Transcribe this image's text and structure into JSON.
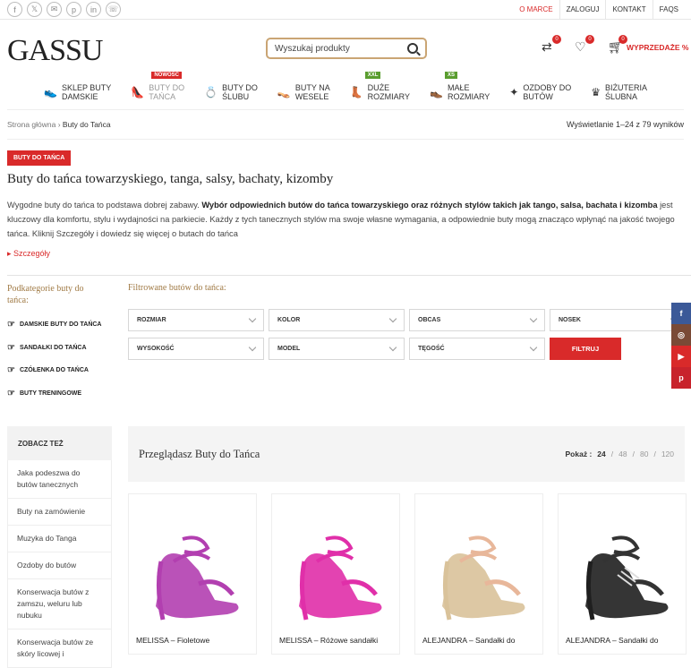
{
  "topbar": {
    "socials": [
      {
        "icon": "facebook-icon",
        "glyph": "f"
      },
      {
        "icon": "x-icon",
        "glyph": "𝕏"
      },
      {
        "icon": "email-icon",
        "glyph": "✉"
      },
      {
        "icon": "pinterest-icon",
        "glyph": "p"
      },
      {
        "icon": "linkedin-icon",
        "glyph": "in"
      },
      {
        "icon": "whatsapp-icon",
        "glyph": "☏"
      }
    ],
    "links": {
      "about": "O MARCE",
      "login": "ZALOGUJ",
      "contact": "KONTAKT",
      "faqs": "FAQS"
    }
  },
  "header": {
    "logo": "GASSU",
    "search_placeholder": "Wyszukaj produkty",
    "compare_count": "0",
    "wishlist_count": "0",
    "cart_count": "0",
    "sale_label": "WYPRZEDAŻE %"
  },
  "nav": [
    {
      "line1": "SKLEP BUTY",
      "line2": "DAMSKIE",
      "icon": "shoes-icon",
      "glyph": "👟",
      "tag": ""
    },
    {
      "line1": "BUTY DO",
      "line2": "TAŃCA",
      "icon": "dance-shoe-icon",
      "glyph": "👠",
      "tag": "NOWOŚĆ",
      "tagColor": "red"
    },
    {
      "line1": "BUTY DO",
      "line2": "ŚLUBU",
      "icon": "wedding-icon",
      "glyph": "💍",
      "tag": ""
    },
    {
      "line1": "BUTY NA",
      "line2": "WESELE",
      "icon": "heel-icon",
      "glyph": "👡",
      "tag": ""
    },
    {
      "line1": "DUŻE",
      "line2": "ROZMIARY",
      "icon": "large-size-icon",
      "glyph": "👢",
      "tag": "XXL",
      "tagColor": "green"
    },
    {
      "line1": "MAŁE",
      "line2": "ROZMIARY",
      "icon": "small-size-icon",
      "glyph": "👞",
      "tag": "XS",
      "tagColor": "green"
    },
    {
      "line1": "OZDOBY DO",
      "line2": "BUTÓW",
      "icon": "ornament-icon",
      "glyph": "✦",
      "tag": ""
    },
    {
      "line1": "BIŻUTERIA",
      "line2": "ŚLUBNA",
      "icon": "jewelry-icon",
      "glyph": "♛",
      "tag": ""
    }
  ],
  "breadcrumb": {
    "home": "Strona główna",
    "sep": " › ",
    "current": "Buty do Tańca"
  },
  "result_count": "Wyświetlanie 1–24 z 79 wyników",
  "category_badge": "BUTY DO TAŃCA",
  "page_title": "Buty do tańca towarzyskiego, tanga, salsy, bachaty, kizomby",
  "description": {
    "part1": "Wygodne buty do tańca to podstawa dobrej zabawy. ",
    "bold": "Wybór odpowiednich butów do tańca towarzyskiego oraz różnych stylów takich jak tango, salsa, bachata i kizomba",
    "part2": " jest kluczowy dla komfortu, stylu i wydajności na parkiecie. Każdy z tych tanecznych stylów ma swoje własne wymagania, a odpowiednie buty mogą znacząco wpłynąć na jakość twojego tańca. Kliknij Szczegóły i dowiedz się więcej o butach do tańca"
  },
  "details_label": "Szczegóły",
  "subcategories": {
    "title": "Podkategorie buty do tańca:",
    "items": [
      "DAMSKIE BUTY DO TAŃCA",
      "SANDAŁKI DO TAŃCA",
      "CZÓŁENKA DO TAŃCA",
      "BUTY TRENINGOWE"
    ]
  },
  "filters": {
    "title": "Filtrowane butów do tańca:",
    "selects": [
      "ROZMIAR",
      "KOLOR",
      "OBCAS",
      "NOSEK",
      "WYSOKOŚĆ",
      "MODEL",
      "TĘGOŚĆ"
    ],
    "button": "FILTRUJ"
  },
  "side_social": [
    {
      "icon": "facebook-icon",
      "glyph": "f",
      "color": "#3b5998"
    },
    {
      "icon": "instagram-icon",
      "glyph": "◎",
      "color": "#7a4a36"
    },
    {
      "icon": "youtube-icon",
      "glyph": "▶",
      "color": "#d92a2a"
    },
    {
      "icon": "pinterest-icon",
      "glyph": "p",
      "color": "#c8232c"
    }
  ],
  "sidebar": {
    "title": "ZOBACZ TEŻ",
    "items": [
      "Jaka podeszwa do butów tanecznych",
      "Buty na zamówienie",
      "Muzyka do Tanga",
      "Ozdoby do butów",
      "Konserwacja butów z zamszu, weluru lub nubuku",
      "Konserwacja butów ze skóry licowej i"
    ]
  },
  "results": {
    "title": "Przeglądasz Buty do Tańca",
    "show_label": "Pokaż :",
    "options": [
      "24",
      "48",
      "80",
      "120"
    ],
    "current": "24"
  },
  "products": [
    {
      "name": "MELISSA – Fioletowe",
      "color": "#b23fb0"
    },
    {
      "name": "MELISSA – Różowe sandałki",
      "color": "#e02fa9"
    },
    {
      "name": "ALEJANDRA – Sandałki do",
      "color": "#d9c29a"
    },
    {
      "name": "ALEJANDRA – Sandałki do",
      "color": "#1f1f1f"
    }
  ],
  "colors": {
    "accent": "#d92a2a",
    "gold": "#a07a45",
    "green": "#5a9d2f"
  }
}
